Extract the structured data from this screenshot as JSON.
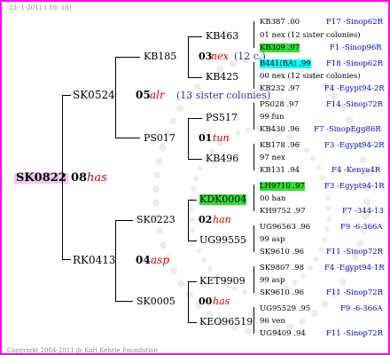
{
  "header": "23- 1-2011 ( 18: 18)",
  "copyright": "Copyright 2004-2011 @ Karl Kehrle Foundation",
  "root": {
    "id": "SK0822",
    "year": "08",
    "name": "has"
  },
  "sire": {
    "id": "SK0524",
    "year": "05",
    "name": "alr",
    "note": "(13 sister colonies)"
  },
  "dam": {
    "id": "RK0413",
    "year": "04",
    "name": "asp"
  },
  "g3": {
    "kb185": "KB185",
    "ps017": "PS017",
    "sk0223": "SK0223",
    "sk0005": "SK0005"
  },
  "g3_years": {
    "kb185": {
      "year": "03",
      "name": "nex",
      "note": "(12 c.)"
    },
    "ps017": {
      "year": "01",
      "name": "tun"
    },
    "sk0223": {
      "year": "02",
      "name": "han"
    },
    "sk0005": {
      "year": "00",
      "name": "has"
    }
  },
  "g4": {
    "kb463": "KB463",
    "kb425": "KB425",
    "ps517": "PS517",
    "kb496": "KB496",
    "kdk0004": "KDK0004",
    "ug99555": "UG99555",
    "ket9909": "KET9909",
    "keo96519": "KEO96519"
  },
  "g5": [
    {
      "a": "KB387 .00",
      "a_right": "F17 -Sinop62R",
      "b": "01 nex (12 sister colonies)",
      "c": "KB309 .97",
      "c_right": "F1 -Sinop96R"
    },
    {
      "a": "B441(BA) .99",
      "a_right": "F18 -Sinop62R",
      "b": "00 nex (12 sister colonies)",
      "c": "KB232 .97",
      "c_right": "F4 -Egypt94-2R"
    },
    {
      "a": "PS028 .97",
      "a_right": "F14 -Sinop72R",
      "b": "99 fun",
      "c": "KB430 .96",
      "c_right": "F7 -SinopEgg86R"
    },
    {
      "a": "KB178 .96",
      "a_right": "F3 -Egypt94-2R",
      "b": "97 nex",
      "c": "KB131 .94",
      "c_right": "F4 -Kenya4R"
    },
    {
      "a": "LH9710 .97",
      "a_right": "F3 -Egypt94-1R",
      "b": "00 han",
      "c": "KH9752 .97",
      "c_right": "F7 -344-13"
    },
    {
      "a": "UG96563 .96",
      "a_right": "F9 -6-366A",
      "b": "99 asp",
      "c": "SK9610 .96",
      "c_right": "F11 -Sinop72R"
    },
    {
      "a": "SK9807 .98",
      "a_right": "F4 -Egypt94-1R",
      "b": "99 asp",
      "c": "SK9610 .96",
      "c_right": "F11 -Sinop72R"
    },
    {
      "a": "UG95529 .95",
      "a_right": "F9 -6-366A",
      "b": "96 ven",
      "c": "UG9409 .94",
      "c_right": "F11 -Sinop72R"
    }
  ]
}
